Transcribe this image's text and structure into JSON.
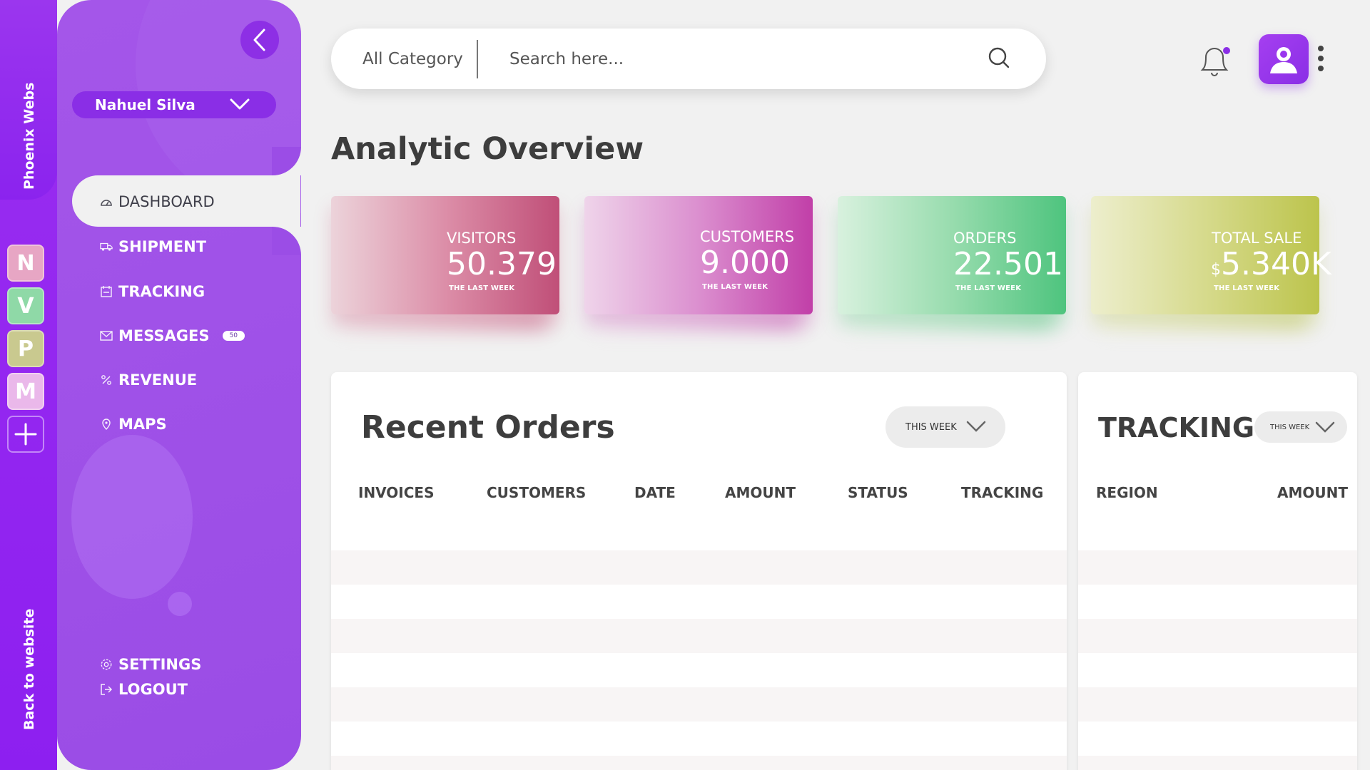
{
  "rail": {
    "brand": "Phoenix Webs",
    "back_link": "Back to website",
    "apps": [
      {
        "letter": "N",
        "color": "#e7a6c4"
      },
      {
        "letter": "V",
        "color": "#8fd9a7"
      },
      {
        "letter": "P",
        "color": "#c9c98f"
      },
      {
        "letter": "M",
        "color": "#eab8ea"
      }
    ]
  },
  "sidebar": {
    "user": "Nahuel Silva",
    "items": [
      {
        "label": "DASHBOARD",
        "icon": "dashboard-icon"
      },
      {
        "label": "SHIPMENT",
        "icon": "truck-icon"
      },
      {
        "label": "TRACKING",
        "icon": "tracking-icon"
      },
      {
        "label": "MESSAGES",
        "icon": "envelope-icon",
        "badge": "50"
      },
      {
        "label": "REVENUE",
        "icon": "percent-icon"
      },
      {
        "label": "MAPS",
        "icon": "map-pin-icon"
      }
    ],
    "settings": "SETTINGS",
    "logout": "LOGOUT"
  },
  "search": {
    "category": "All Category",
    "placeholder": "Search here..."
  },
  "page_title": "Analytic Overview",
  "stats": [
    {
      "label": "VISITORS",
      "value": "50.379",
      "sub": "THE LAST WEEK"
    },
    {
      "label": "CUSTOMERS",
      "value": "9.000",
      "sub": "THE LAST WEEK"
    },
    {
      "label": "ORDERS",
      "value": "22.501",
      "sub": "THE LAST WEEK"
    },
    {
      "label": "TOTAL SALE",
      "currency": "$",
      "value": "5.340K",
      "sub": "THE LAST WEEK"
    }
  ],
  "recent_orders": {
    "title": "Recent Orders",
    "period": "THIS WEEK",
    "columns": [
      "INVOICES",
      "CUSTOMERS",
      "DATE",
      "AMOUNT",
      "STATUS",
      "TRACKING"
    ]
  },
  "tracking": {
    "title": "TRACKING",
    "period": "THIS WEEK",
    "columns": [
      "REGION",
      "AMOUNT"
    ]
  },
  "colors": {
    "accent": "#8d2fe5",
    "panel": "#9b4de6",
    "notification_dot": "#8a2ee6"
  }
}
